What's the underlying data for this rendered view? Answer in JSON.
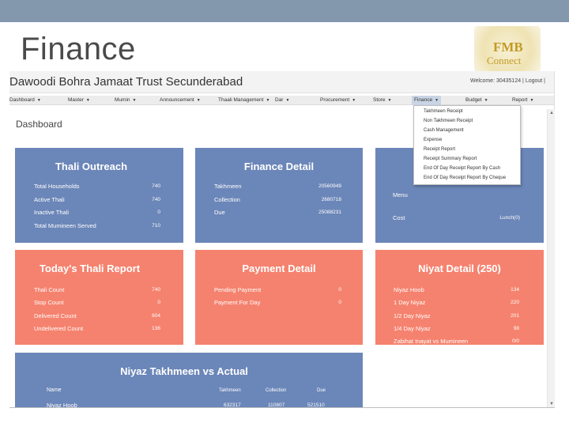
{
  "slide": {
    "title": "Finance",
    "logo_line1": "FMB",
    "logo_line2": "Connect"
  },
  "app": {
    "name": "Dawoodi Bohra Jamaat Trust Secunderabad",
    "welcome": "Welcome: 30435124 | Logout |"
  },
  "nav": [
    {
      "label": "Dashboard"
    },
    {
      "label": "Master"
    },
    {
      "label": "Mumin"
    },
    {
      "label": "Announcement"
    },
    {
      "label": "Thaali Management"
    },
    {
      "label": "Dar"
    },
    {
      "label": "Procurement"
    },
    {
      "label": "Store"
    },
    {
      "label": "Finance"
    },
    {
      "label": "Budget"
    },
    {
      "label": "Report"
    }
  ],
  "page_title": "Dashboard",
  "dropdown": [
    "Takhmeen Receipt",
    "Non Takhmeen Receipt",
    "Cash Management",
    "Expense",
    "Receipt Report",
    "Receipt Summary Report",
    "End Of Day Receipt Report By Cash",
    "End Of Day Receipt Report By Cheque"
  ],
  "cards": {
    "thali_outreach": {
      "title": "Thali Outreach",
      "rows": [
        {
          "label": "Total Households",
          "value": "740"
        },
        {
          "label": "Active Thali",
          "value": "740"
        },
        {
          "label": "Inactive Thali",
          "value": "0"
        },
        {
          "label": "Total Mumineen Served",
          "value": "710"
        }
      ]
    },
    "finance_detail": {
      "title": "Finance Detail",
      "rows": [
        {
          "label": "Takhmeen",
          "value": "20560949"
        },
        {
          "label": "Collection",
          "value": "2680718"
        },
        {
          "label": "Due",
          "value": "25088231"
        }
      ]
    },
    "menu_card": {
      "rows": [
        {
          "label": "Menu"
        },
        {
          "label": "Cost",
          "value": "Lunch(0)"
        }
      ]
    },
    "todays_thali": {
      "title": "Today's Thali Report",
      "rows": [
        {
          "label": "Thali Count",
          "value": "740"
        },
        {
          "label": "Stop Count",
          "value": "0"
        },
        {
          "label": "Delivered Count",
          "value": "604"
        },
        {
          "label": "Undelivered Count",
          "value": "136"
        }
      ]
    },
    "payment_detail": {
      "title": "Payment Detail",
      "rows": [
        {
          "label": "Pending Payment",
          "value": "0"
        },
        {
          "label": "Payment For Day",
          "value": "0"
        }
      ]
    },
    "niyat_detail": {
      "title": "Niyat Detail (250)",
      "rows": [
        {
          "label": "Niyaz Hoob",
          "value": "134"
        },
        {
          "label": "1 Day Niyaz",
          "value": "220"
        },
        {
          "label": "1/2 Day Niyaz",
          "value": "201"
        },
        {
          "label": "1/4 Day Niyaz",
          "value": "98"
        },
        {
          "label": "Zabihat Inayat vs Mumineen",
          "value": "0/0"
        }
      ]
    },
    "niyaz_takhmeen": {
      "title": "Niyaz Takhmeen vs Actual",
      "columns": [
        "Name",
        "Takhmeen",
        "Collection",
        "Due"
      ],
      "rows": [
        {
          "name": "Niyaz Hoob",
          "takhmeen": "632317",
          "collection": "110807",
          "due": "521510"
        }
      ]
    }
  }
}
